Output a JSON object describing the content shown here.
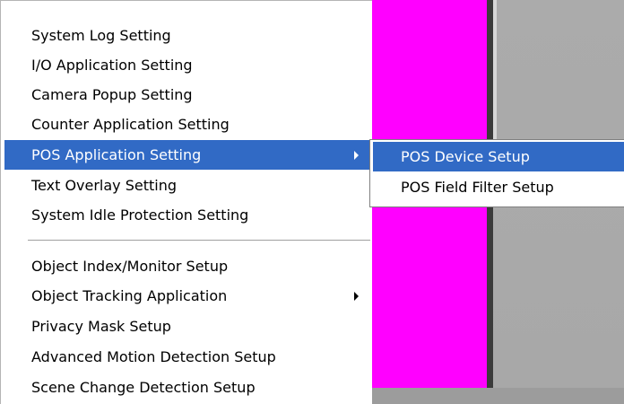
{
  "menu": {
    "items": [
      {
        "label": "System Log Setting"
      },
      {
        "label": "I/O Application Setting"
      },
      {
        "label": "Camera Popup Setting"
      },
      {
        "label": "Counter Application Setting"
      },
      {
        "label": "POS Application Setting",
        "has_submenu": true,
        "highlighted": true
      },
      {
        "label": "Text Overlay Setting"
      },
      {
        "label": "System Idle Protection Setting"
      },
      {
        "label": "Object Index/Monitor Setup"
      },
      {
        "label": "Object Tracking Application",
        "has_submenu": true
      },
      {
        "label": "Privacy Mask Setup"
      },
      {
        "label": "Advanced Motion Detection Setup"
      },
      {
        "label": "Scene Change Detection Setup"
      }
    ]
  },
  "submenu": {
    "items": [
      {
        "label": "POS Device Setup",
        "highlighted": true
      },
      {
        "label": "POS Field Filter Setup"
      }
    ]
  },
  "colors": {
    "highlight": "#316ac5",
    "background_panel": "#ff00ff",
    "menu_background": "#ffffff"
  }
}
